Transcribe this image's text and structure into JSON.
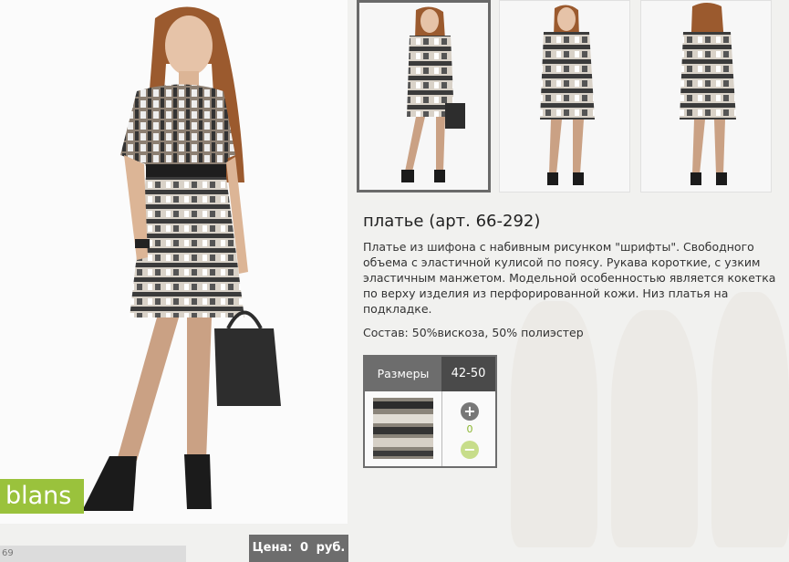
{
  "product": {
    "title": "платье (арт. 66-292)",
    "description": "Платье из шифона с набивным рисунком \"шрифты\". Свободного объема с эластичной кулисой по поясу. Рукава короткие, с узким эластичным манжетом. Модельной особенностью является кокетка по верху изделия из перфорированной кожи. Низ платья на подкладке.",
    "composition": "Состав: 50%вискоза, 50% полиэстер"
  },
  "brand": {
    "logo_text": "blans"
  },
  "price": {
    "label": "Цена:",
    "value": "0",
    "currency": "руб."
  },
  "footer": {
    "number_fragment": "69"
  },
  "size_table": {
    "header_label": "Размеры",
    "size_range": "42-50",
    "quantity": "0",
    "plus_icon": "plus-circle-icon",
    "minus_icon": "minus-circle-icon"
  },
  "thumbnails": [
    {
      "name": "front-pose",
      "selected": true
    },
    {
      "name": "front-view",
      "selected": false
    },
    {
      "name": "back-view",
      "selected": false
    }
  ],
  "colors": {
    "brand_green": "#9ac23c",
    "header_gray": "#6d6d6d",
    "header_dark": "#4a4a4a",
    "qty_green": "#8ab52e"
  }
}
